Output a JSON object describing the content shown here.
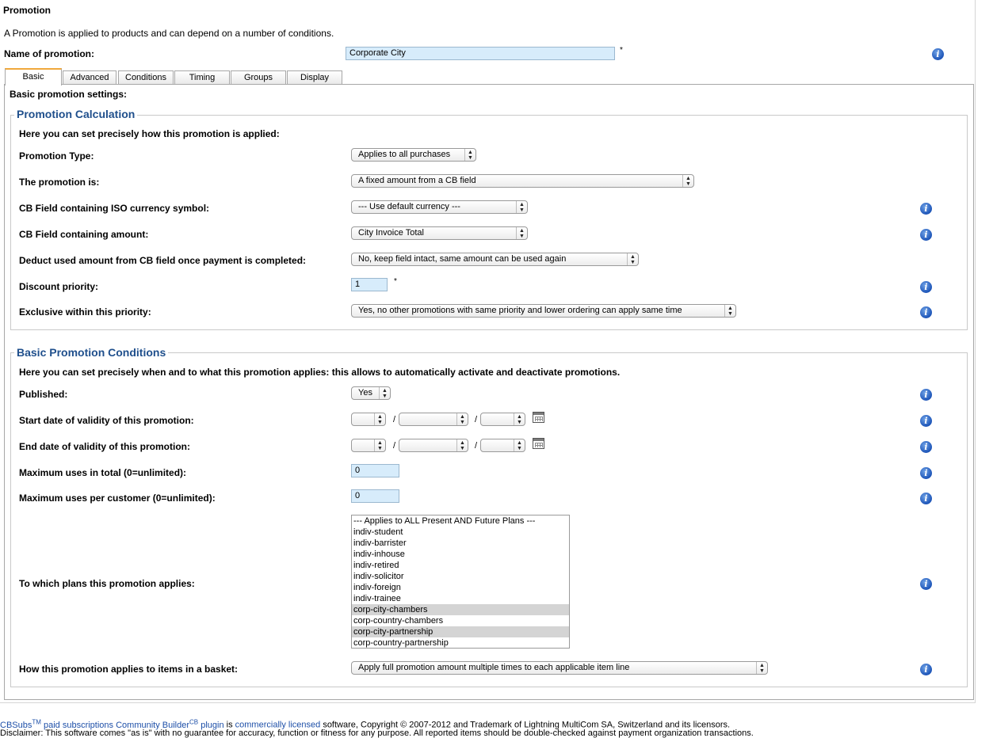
{
  "page": {
    "title": "Promotion",
    "description": "A Promotion is applied to products and can depend on a number of conditions.",
    "name_label": "Name of promotion:",
    "name_value": "Corporate City",
    "required_mark": "*"
  },
  "tabs": [
    {
      "label": "Basic",
      "active": true
    },
    {
      "label": "Advanced"
    },
    {
      "label": "Conditions"
    },
    {
      "label": "Timing"
    },
    {
      "label": "Groups"
    },
    {
      "label": "Display"
    }
  ],
  "basic": {
    "heading": "Basic promotion settings:"
  },
  "calc": {
    "legend": "Promotion Calculation",
    "intro": "Here you can set precisely how this promotion is applied:",
    "type_label": "Promotion Type:",
    "type_value": "Applies to all purchases",
    "is_label": "The promotion is:",
    "is_value": "A fixed amount from a CB field",
    "currency_label": "CB Field containing ISO currency symbol:",
    "currency_value": "--- Use default currency ---",
    "amount_label": "CB Field containing amount:",
    "amount_value": "City Invoice Total",
    "deduct_label": "Deduct used amount from CB field once payment is completed:",
    "deduct_value": "No, keep field intact, same amount can be used again",
    "priority_label": "Discount priority:",
    "priority_value": "1",
    "exclusive_label": "Exclusive within this priority:",
    "exclusive_value": "Yes, no other promotions with same priority and lower ordering can apply same time"
  },
  "conditions": {
    "legend": "Basic Promotion Conditions",
    "intro": "Here you can set precisely when and to what this promotion applies: this allows to automatically activate and deactivate promotions.",
    "published_label": "Published:",
    "published_value": "Yes",
    "start_label": "Start date of validity of this promotion:",
    "end_label": "End date of validity of this promotion:",
    "date_separator": "/",
    "max_total_label": "Maximum uses in total (0=unlimited):",
    "max_total_value": "0",
    "max_customer_label": "Maximum uses per customer (0=unlimited):",
    "max_customer_value": "0",
    "plans_label": "To which plans this promotion applies:",
    "plans": [
      {
        "label": "--- Applies to ALL Present AND Future Plans ---",
        "selected": false
      },
      {
        "label": "indiv-student",
        "selected": false
      },
      {
        "label": "indiv-barrister",
        "selected": false
      },
      {
        "label": "indiv-inhouse",
        "selected": false
      },
      {
        "label": "indiv-retired",
        "selected": false
      },
      {
        "label": "indiv-solicitor",
        "selected": false
      },
      {
        "label": "indiv-foreign",
        "selected": false
      },
      {
        "label": "indiv-trainee",
        "selected": false
      },
      {
        "label": "corp-city-chambers",
        "selected": true
      },
      {
        "label": "corp-country-chambers",
        "selected": false
      },
      {
        "label": "corp-city-partnership",
        "selected": true
      },
      {
        "label": "corp-country-partnership",
        "selected": false
      }
    ],
    "basket_label": "How this promotion applies to items in a basket:",
    "basket_value": "Apply full promotion amount multiple times to each applicable item line"
  },
  "footer": {
    "cbsubs": "CBSubs",
    "tm": "TM",
    "paid_subs": "paid subscriptions",
    "cb": "Community Builder",
    "cb_sup": "CB",
    "plugin": "plugin",
    "is": "is",
    "licensed": "commercially licensed",
    "rest": "software, Copyright © 2007-2012 and Trademark of Lightning MultiCom SA, Switzerland and its licensors.",
    "disclaimer": "Disclaimer: This software comes \"as is\" with no guarantee for accuracy, function or fitness for any purpose. All reported items should be double-checked against payment organization transactions."
  },
  "colors": {
    "legend_blue": "#1f4f8c",
    "input_blue": "#d7ecfb",
    "active_tab_accent": "#f0a83b",
    "link_blue": "#1d4fa8"
  },
  "icons": {
    "info": "info-icon",
    "calendar": "calendar-icon",
    "select_arrows": "select-arrows-icon"
  }
}
